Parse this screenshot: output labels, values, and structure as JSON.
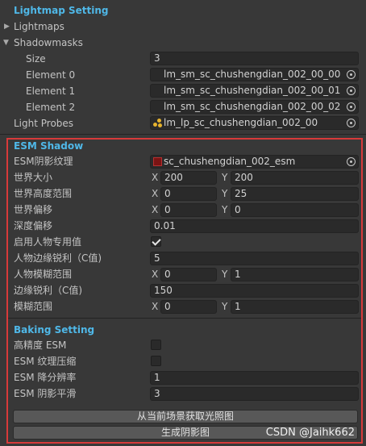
{
  "lightmap_setting": {
    "title": "Lightmap Setting",
    "lightmaps_label": "Lightmaps",
    "shadowmasks_label": "Shadowmasks",
    "size_label": "Size",
    "size_value": "3",
    "elements": [
      {
        "label": "Element 0",
        "value": "lm_sm_sc_chushengdian_002_00_00"
      },
      {
        "label": "Element 1",
        "value": "lm_sm_sc_chushengdian_002_00_01"
      },
      {
        "label": "Element 2",
        "value": "lm_sm_sc_chushengdian_002_00_02"
      }
    ],
    "light_probes_label": "Light Probes",
    "light_probes_value": "lm_lp_sc_chushengdian_002_00"
  },
  "esm_shadow": {
    "title": "ESM Shadow",
    "texture_label": "ESM阴影纹理",
    "texture_value": "sc_chushengdian_002_esm",
    "world_size_label": "世界大小",
    "world_size": {
      "x": "200",
      "y": "200"
    },
    "world_height_label": "世界高度范围",
    "world_height": {
      "x": "0",
      "y": "25"
    },
    "world_offset_label": "世界偏移",
    "world_offset": {
      "x": "0",
      "y": "0"
    },
    "depth_offset_label": "深度偏移",
    "depth_offset": "0.01",
    "character_enable_label": "启用人物专用值",
    "character_enable": true,
    "character_sharpness_label": "人物边缘锐利（C值)",
    "character_sharpness": "5",
    "character_blur_label": "人物模糊范围",
    "character_blur": {
      "x": "0",
      "y": "1"
    },
    "edge_sharpness_label": "边缘锐利（C值)",
    "edge_sharpness": "150",
    "blur_range_label": "模糊范围",
    "blur_range": {
      "x": "0",
      "y": "1"
    },
    "axis_x": "X",
    "axis_y": "Y"
  },
  "baking_setting": {
    "title": "Baking Setting",
    "high_precision_label": "高精度 ESM",
    "high_precision": false,
    "texture_compress_label": "ESM 纹理压缩",
    "texture_compress": false,
    "downsample_label": "ESM 降分辨率",
    "downsample": "1",
    "smooth_label": "ESM 阴影平滑",
    "smooth": "3"
  },
  "buttons": {
    "capture_label": "从当前场景获取光照图",
    "generate_label": "生成阴影图"
  },
  "watermark": "CSDN @Jaihk662",
  "colors": {
    "section_title": "#4fb8e8",
    "highlight_frame": "#d83a3a",
    "background": "#383838"
  }
}
